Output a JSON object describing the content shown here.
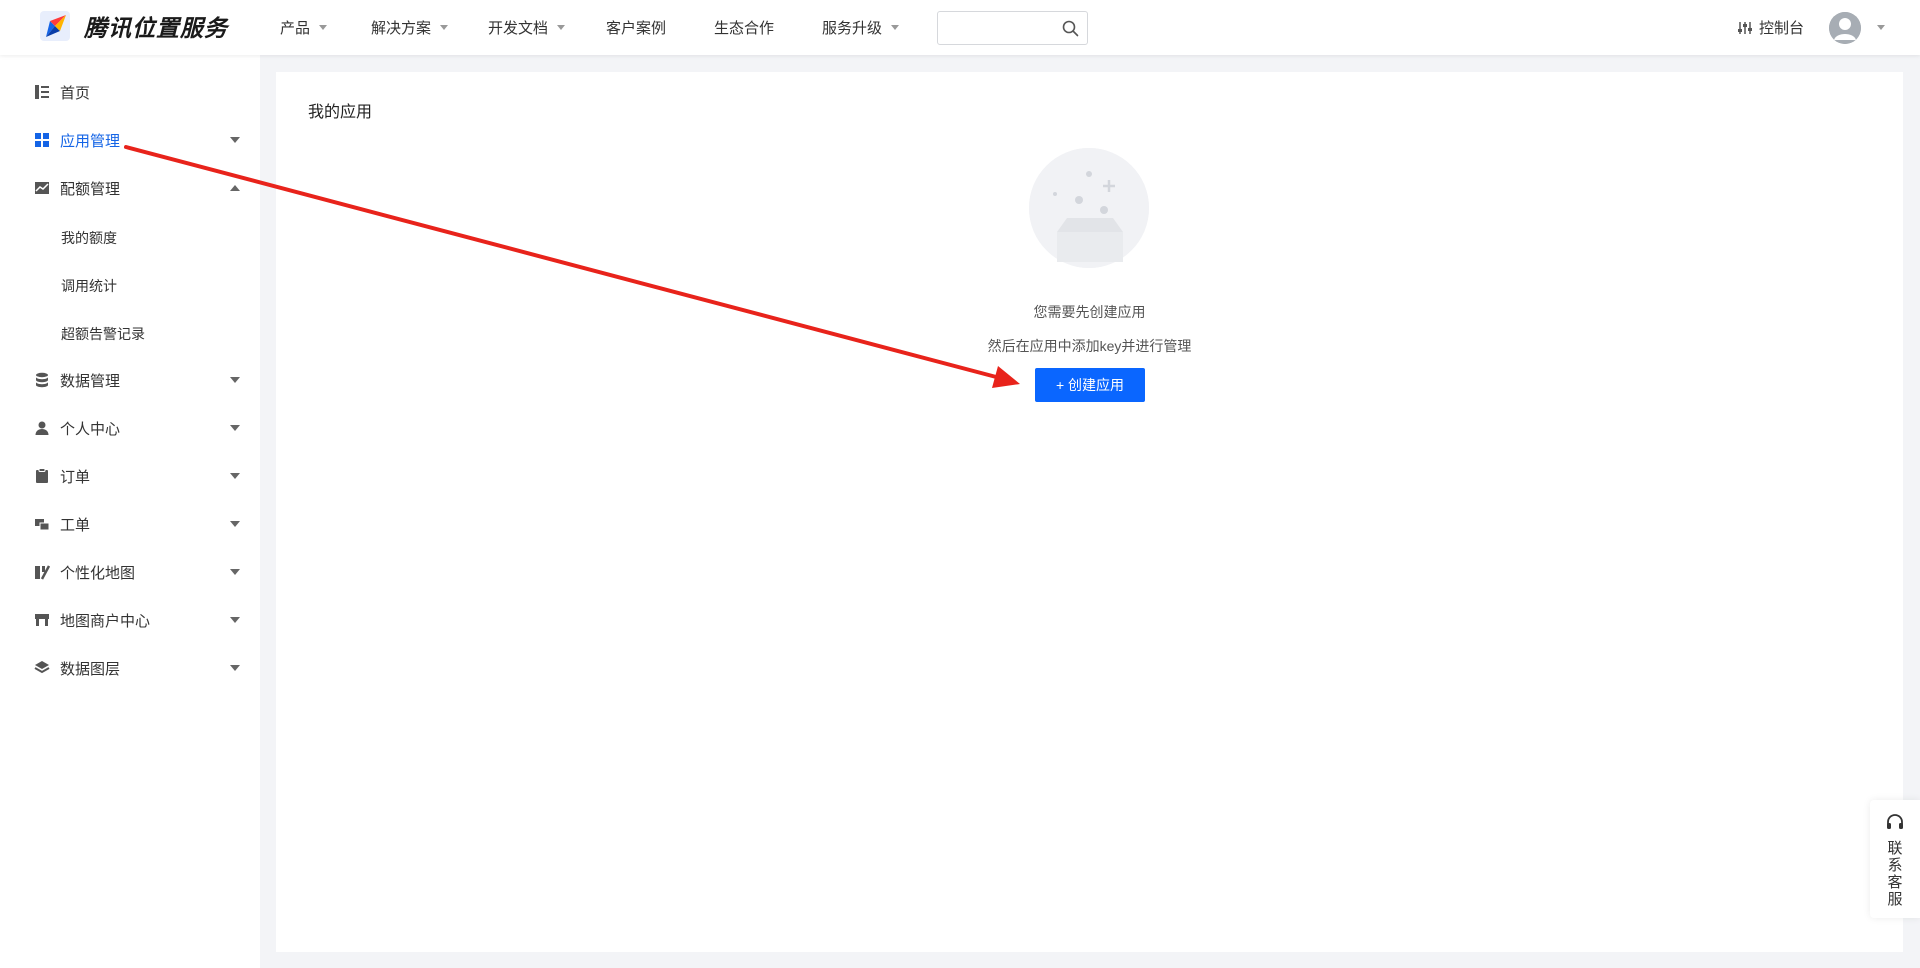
{
  "brand": {
    "name": "腾讯位置服务"
  },
  "nav": {
    "items": [
      {
        "label": "产品",
        "dropdown": true
      },
      {
        "label": "解决方案",
        "dropdown": true
      },
      {
        "label": "开发文档",
        "dropdown": true
      },
      {
        "label": "客户案例",
        "dropdown": false
      },
      {
        "label": "生态合作",
        "dropdown": false
      },
      {
        "label": "服务升级",
        "dropdown": true
      }
    ],
    "search_placeholder": "",
    "console_label": "控制台"
  },
  "sidebar": {
    "items": [
      {
        "label": "首页",
        "icon": "list-icon",
        "arrow": "none"
      },
      {
        "label": "应用管理",
        "icon": "grid-icon",
        "arrow": "down",
        "active": true
      },
      {
        "label": "配额管理",
        "icon": "chart-icon",
        "arrow": "up"
      },
      {
        "label": "数据管理",
        "icon": "database-icon",
        "arrow": "down"
      },
      {
        "label": "个人中心",
        "icon": "user-icon",
        "arrow": "down"
      },
      {
        "label": "订单",
        "icon": "clipboard-icon",
        "arrow": "down"
      },
      {
        "label": "工单",
        "icon": "ticket-icon",
        "arrow": "down"
      },
      {
        "label": "个性化地图",
        "icon": "map-style-icon",
        "arrow": "down"
      },
      {
        "label": "地图商户中心",
        "icon": "store-icon",
        "arrow": "down"
      },
      {
        "label": "数据图层",
        "icon": "layers-icon",
        "arrow": "down"
      }
    ],
    "quota_sub": [
      "我的额度",
      "调用统计",
      "超额告警记录"
    ]
  },
  "main": {
    "title": "我的应用",
    "empty_line1": "您需要先创建应用",
    "empty_line2": "然后在应用中添加key并进行管理",
    "create_button": "+ 创建应用"
  },
  "contact": {
    "label": "联系客服"
  },
  "colors": {
    "accent": "#0a66ff",
    "active_text": "#1464e6",
    "annotation_arrow": "#e8231b"
  }
}
